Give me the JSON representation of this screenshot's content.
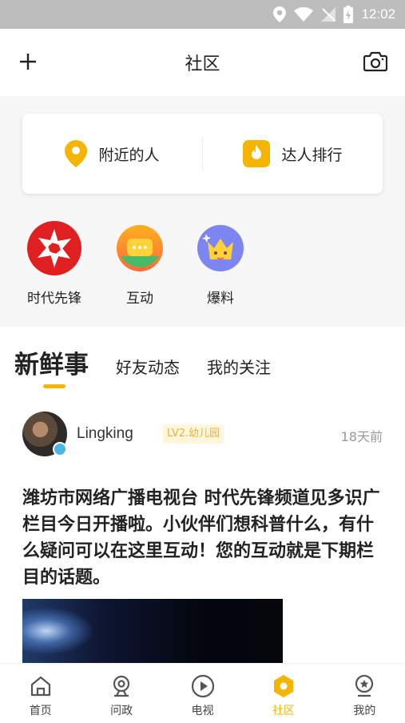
{
  "status_bar": {
    "time": "12:02"
  },
  "header": {
    "title": "社区"
  },
  "quick_links": [
    {
      "label": "附近的人",
      "icon": "location-pin-icon"
    },
    {
      "label": "达人排行",
      "icon": "flame-icon"
    }
  ],
  "features": [
    {
      "label": "时代先锋",
      "icon": "aperture-icon"
    },
    {
      "label": "互动",
      "icon": "chat-bubble-icon"
    },
    {
      "label": "爆料",
      "icon": "crown-face-icon"
    }
  ],
  "feed": {
    "tabs": [
      {
        "label": "新鲜事",
        "active": true
      },
      {
        "label": "好友动态",
        "active": false
      },
      {
        "label": "我的关注",
        "active": false
      }
    ],
    "post": {
      "username": "Lingking",
      "level": "LV2.幼儿园",
      "time": "18天前",
      "text": "潍坊市网络广播电视台 时代先锋频道见多识广 栏目今日开播啦。小伙伴们想科普什么，有什么疑问可以在这里互动！您的互动就是下期栏目的话题。"
    }
  },
  "bottom_nav": [
    {
      "label": "首页",
      "icon": "home-icon",
      "active": false
    },
    {
      "label": "问政",
      "icon": "webcam-icon",
      "active": false
    },
    {
      "label": "电视",
      "icon": "play-icon",
      "active": false
    },
    {
      "label": "社区",
      "icon": "hexagon-icon",
      "active": true
    },
    {
      "label": "我的",
      "icon": "profile-star-icon",
      "active": false
    }
  ],
  "colors": {
    "accent": "#f5b400",
    "background": "#f7f7f7"
  }
}
